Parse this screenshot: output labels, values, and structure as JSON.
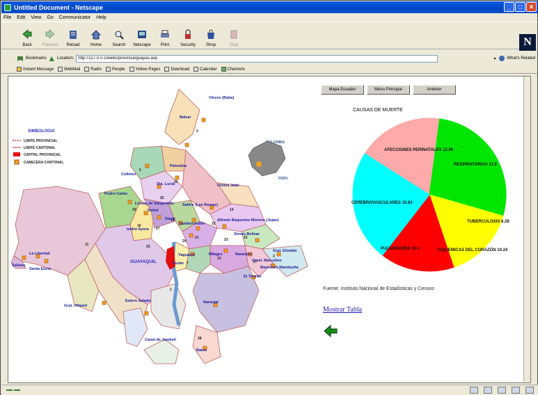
{
  "window": {
    "title": "Untitled Document - Netscape"
  },
  "menu": [
    "File",
    "Edit",
    "View",
    "Go",
    "Communicator",
    "Help"
  ],
  "toolbar": [
    {
      "label": "Back",
      "icon": "back-icon",
      "enabled": true
    },
    {
      "label": "Forward",
      "icon": "forward-icon",
      "enabled": false
    },
    {
      "label": "Reload",
      "icon": "reload-icon",
      "enabled": true
    },
    {
      "label": "Home",
      "icon": "home-icon",
      "enabled": true
    },
    {
      "label": "Search",
      "icon": "search-icon",
      "enabled": true
    },
    {
      "label": "Netscape",
      "icon": "netscape-icon",
      "enabled": true
    },
    {
      "label": "Print",
      "icon": "print-icon",
      "enabled": true
    },
    {
      "label": "Security",
      "icon": "security-icon",
      "enabled": true
    },
    {
      "label": "Shop",
      "icon": "shop-icon",
      "enabled": true
    },
    {
      "label": "Stop",
      "icon": "stop-icon",
      "enabled": false
    }
  ],
  "location": {
    "bookmarks_label": "Bookmarks",
    "location_label": "Location:",
    "url": "http://127.0.0.1/webs/provincia/guayas.asp",
    "whats_related": "What's Related"
  },
  "personal_toolbar": [
    "Instant Message",
    "WebMail",
    "Radio",
    "People",
    "Yellow Pages",
    "Download",
    "Calendar",
    "Channels"
  ],
  "nav_buttons": [
    "Mapa Ecuador",
    "Menu Principal",
    "Anterior"
  ],
  "map": {
    "legend_title": "SIMBOLOGIA",
    "legend": [
      {
        "label": "LIMITE PROVINCIAL",
        "color": "#d03030"
      },
      {
        "label": "LIMITE CANTONAL",
        "color": "#d03030"
      },
      {
        "label": "CAPITAL PROVINCIAL",
        "color": "#e01010"
      },
      {
        "label": "CABECERA CANTONAL",
        "color": "#f0a020"
      }
    ],
    "labels": [
      "Balzar",
      "Colimes",
      "Palestina",
      "Sta. Lucía",
      "Vinces (Baba)",
      "Pedro Carbo",
      "Isidro Ayora",
      "Lomas de Sargentillo",
      "Nobol",
      "Daule",
      "Salitre (Las Ramas)",
      "Samborondón",
      "Urbina Jado",
      "Alfredo Baquerizo Moreno (Jujan)",
      "Simón Bolívar",
      "Milagro",
      "Naranjito",
      "Crnel. Marcelino",
      "El Triunfo",
      "Yaguachi",
      "Durán",
      "Naranjal",
      "Balao",
      "Gral. Villamil",
      "Estero Salado",
      "Canal de Jambelí",
      "Santa Elena",
      "La Libertad",
      "Salinas",
      "GUAYAQUIL",
      "COLOMBIA",
      "PERU",
      "Gral. Elizalde",
      "Marcelino Maridueña"
    ],
    "region_numbers": [
      "11",
      "1",
      "2",
      "3",
      "5",
      "7",
      "13",
      "14",
      "15",
      "16",
      "17",
      "18",
      "19",
      "20",
      "21",
      "22",
      "23",
      "24",
      "25",
      "26",
      "27",
      "28"
    ]
  },
  "chart_title": "CAUSAS DE MUERTE",
  "chart_data": {
    "type": "pie",
    "title": "CAUSAS DE MUERTE",
    "slices": [
      {
        "label": "AFECCIONES PERINATALES",
        "value": 12.06,
        "color": "#ffaaaa"
      },
      {
        "label": "RESPIRATORIAS",
        "value": 11.9,
        "color": "#00e600"
      },
      {
        "label": "TUBERCULOSIS",
        "value": 6.28,
        "color": "#00e600"
      },
      {
        "label": "ISQUEMICAS DEL CORAZÓN",
        "value": 10.24,
        "color": "#ffff00"
      },
      {
        "label": "PULMONARES",
        "value": 10.4,
        "color": "#ff0000"
      },
      {
        "label": "CEREBROVASCULARES",
        "value": 15.63,
        "color": "#00ffff"
      }
    ],
    "printed_labels": [
      "AFECCIONES PERINATALES 12.06",
      "RESPIRATORIAS 11.9",
      "TUBERCULOSIS 6.28",
      "ISQUEMICAS DEL CORAZÓN 10.24",
      "PULMONARES 10.4",
      "CEREBROVASCULARES 15.63"
    ]
  },
  "source_text": "Fuente: Instituto Nacional de Estadísticas y Censos",
  "show_table_link": "Mostrar Tabla"
}
